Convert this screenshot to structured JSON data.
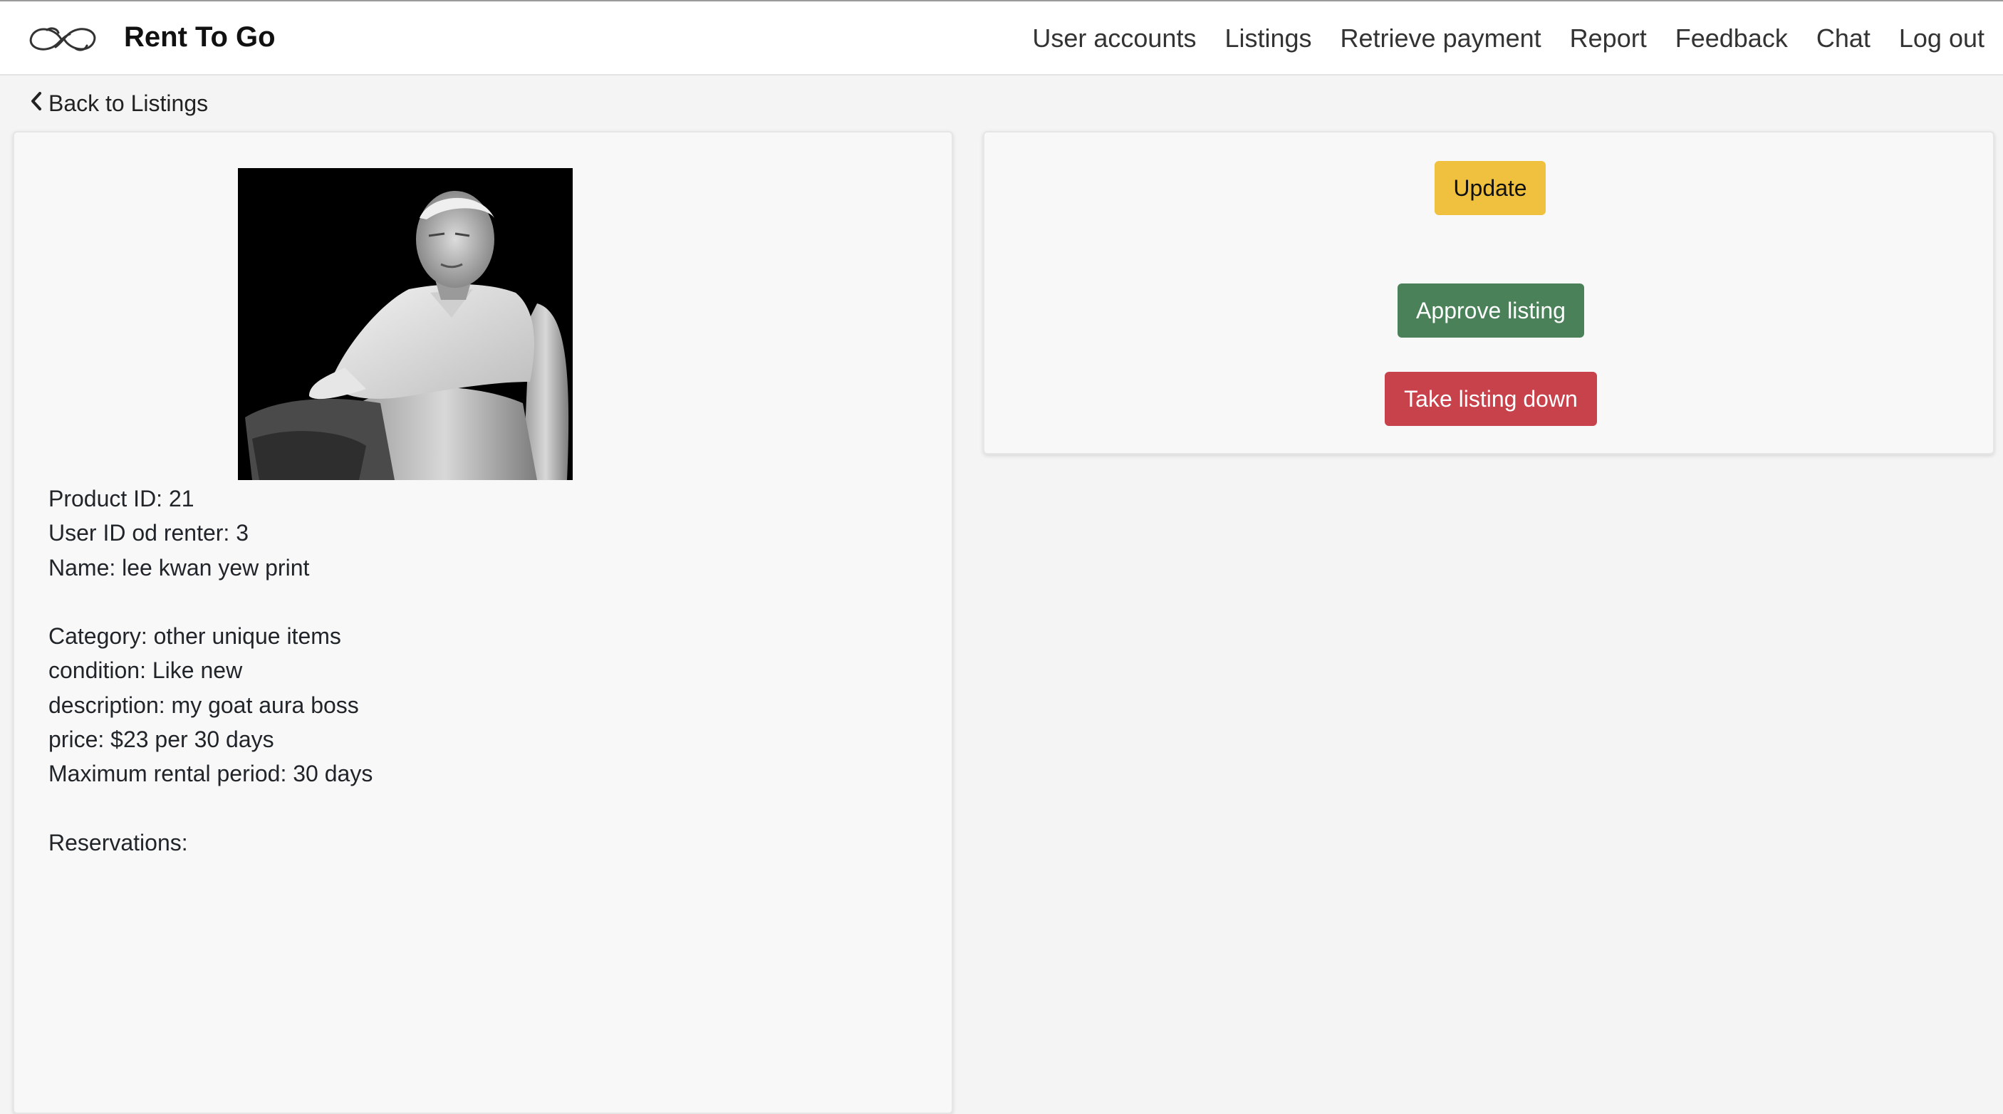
{
  "brand": {
    "name": "Rent To Go",
    "logo_icon": "infinity-loops-logo"
  },
  "nav": {
    "items": [
      {
        "label": "User accounts"
      },
      {
        "label": "Listings"
      },
      {
        "label": "Retrieve payment"
      },
      {
        "label": "Report"
      },
      {
        "label": "Feedback"
      },
      {
        "label": "Chat"
      },
      {
        "label": "Log out"
      }
    ]
  },
  "back": {
    "label": "Back to Listings",
    "icon": "chevron-left-icon"
  },
  "product": {
    "image_icon": "product-photo",
    "details": {
      "product_id": "Product ID: 21",
      "user_id": "User ID od renter: 3",
      "name": "Name: lee kwan yew print",
      "category": "Category: other unique items",
      "condition": "condition: Like new",
      "description": "description: my goat aura boss",
      "price": "price: $23 per 30 days",
      "max_period": "Maximum rental period: 30 days",
      "reservations": "Reservations:"
    }
  },
  "actions": {
    "update_label": "Update",
    "approve_label": "Approve listing",
    "takedown_label": "Take listing down"
  },
  "colors": {
    "update": "#f0c13f",
    "approve": "#4a8158",
    "takedown": "#c8424b",
    "background": "#f4f4f4",
    "card": "#f8f8f8"
  }
}
